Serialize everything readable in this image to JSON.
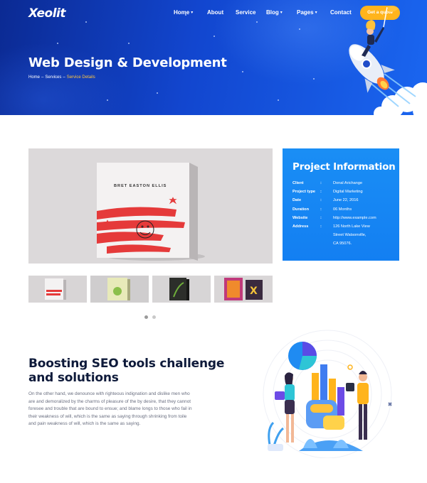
{
  "brand": {
    "logo": "Xeolit"
  },
  "nav": {
    "items": [
      {
        "label": "Home",
        "dropdown": true
      },
      {
        "label": "About",
        "dropdown": false
      },
      {
        "label": "Service",
        "dropdown": false
      },
      {
        "label": "Blog",
        "dropdown": true
      },
      {
        "label": "Pages",
        "dropdown": true
      },
      {
        "label": "Contact",
        "dropdown": false
      }
    ],
    "cta": "Get a quote"
  },
  "hero": {
    "title": "Web Design & Development",
    "breadcrumb": [
      "Home",
      "Services",
      "Service Details"
    ],
    "breadcrumb_separator": "–"
  },
  "gallery": {
    "main_book_author": "BRET EASTON ELLIS",
    "thumbnails": [
      "thumb-1",
      "thumb-2",
      "thumb-3",
      "thumb-4"
    ],
    "active_slide": 1,
    "slide_count": 2
  },
  "project_info": {
    "title": "Project Information",
    "rows": [
      {
        "key": "Client",
        "value": "Donal Arichange"
      },
      {
        "key": "Project type",
        "value": "Digital Marketing"
      },
      {
        "key": "Date",
        "value": "June 22, 2016"
      },
      {
        "key": "Duration",
        "value": "06 Months"
      },
      {
        "key": "Website",
        "value": "http://www.example.com"
      },
      {
        "key": "Address",
        "value": "126 North Lake View"
      }
    ],
    "address_lines": [
      "Street Watsonville,",
      "CA 95076."
    ],
    "colon": ":"
  },
  "seo": {
    "title_lines": [
      "Boosting SEO tools challenge",
      "and solutions"
    ],
    "body_lines": [
      "On the other hand, we denounce with righteous indignation and dislike men who",
      "are and demoralized by the charms of pleasure of the by desire, that they cannot",
      "foresee and trouble that are bound to ensue; and blame longs to those who fail in",
      "their weakness of will, which is the same as saying through shrinking from toile",
      "and pain weakness of will, which is the same as saying."
    ]
  },
  "colors": {
    "hero_dark": "#0b2a93",
    "hero_light": "#1a66f0",
    "accent_yellow": "#ffb41c",
    "breadcrumb_active": "#ffc640",
    "info_blue": "#137ff2",
    "heading_dark": "#0e1a3a",
    "body_gray": "#6a6f80"
  },
  "icons": [
    "chevron-down-icon",
    "rocket-illustration",
    "seo-team-illustration"
  ]
}
